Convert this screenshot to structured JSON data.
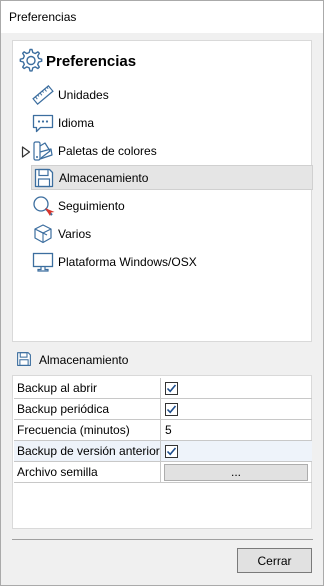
{
  "window": {
    "title": "Preferencias"
  },
  "tree": {
    "root_label": "Preferencias",
    "items": [
      {
        "label": "Unidades",
        "icon": "ruler-icon"
      },
      {
        "label": "Idioma",
        "icon": "speech-bubble-icon"
      },
      {
        "label": "Paletas de colores",
        "icon": "color-palette-icon",
        "expandable": true
      },
      {
        "label": "Almacenamiento",
        "icon": "floppy-disk-icon",
        "selected": true
      },
      {
        "label": "Seguimiento",
        "icon": "magnifier-icon"
      },
      {
        "label": "Varios",
        "icon": "boxes-icon"
      },
      {
        "label": "Plataforma Windows/OSX",
        "icon": "monitor-icon"
      }
    ]
  },
  "section": {
    "label": "Almacenamiento"
  },
  "properties": [
    {
      "name": "Backup al abrir",
      "type": "checkbox",
      "checked": true
    },
    {
      "name": "Backup periódica",
      "type": "checkbox",
      "checked": true
    },
    {
      "name": "Frecuencia (minutos)",
      "type": "text",
      "value": "5"
    },
    {
      "name": "Backup de versión anterior",
      "type": "checkbox",
      "checked": true
    },
    {
      "name": "Archivo semilla",
      "type": "button",
      "value": "..."
    }
  ],
  "footer": {
    "close_label": "Cerrar"
  },
  "colors": {
    "icon_blue": "#3c6e9f",
    "selection_bg": "#e5e5e5",
    "accent_red": "#d9342b"
  }
}
